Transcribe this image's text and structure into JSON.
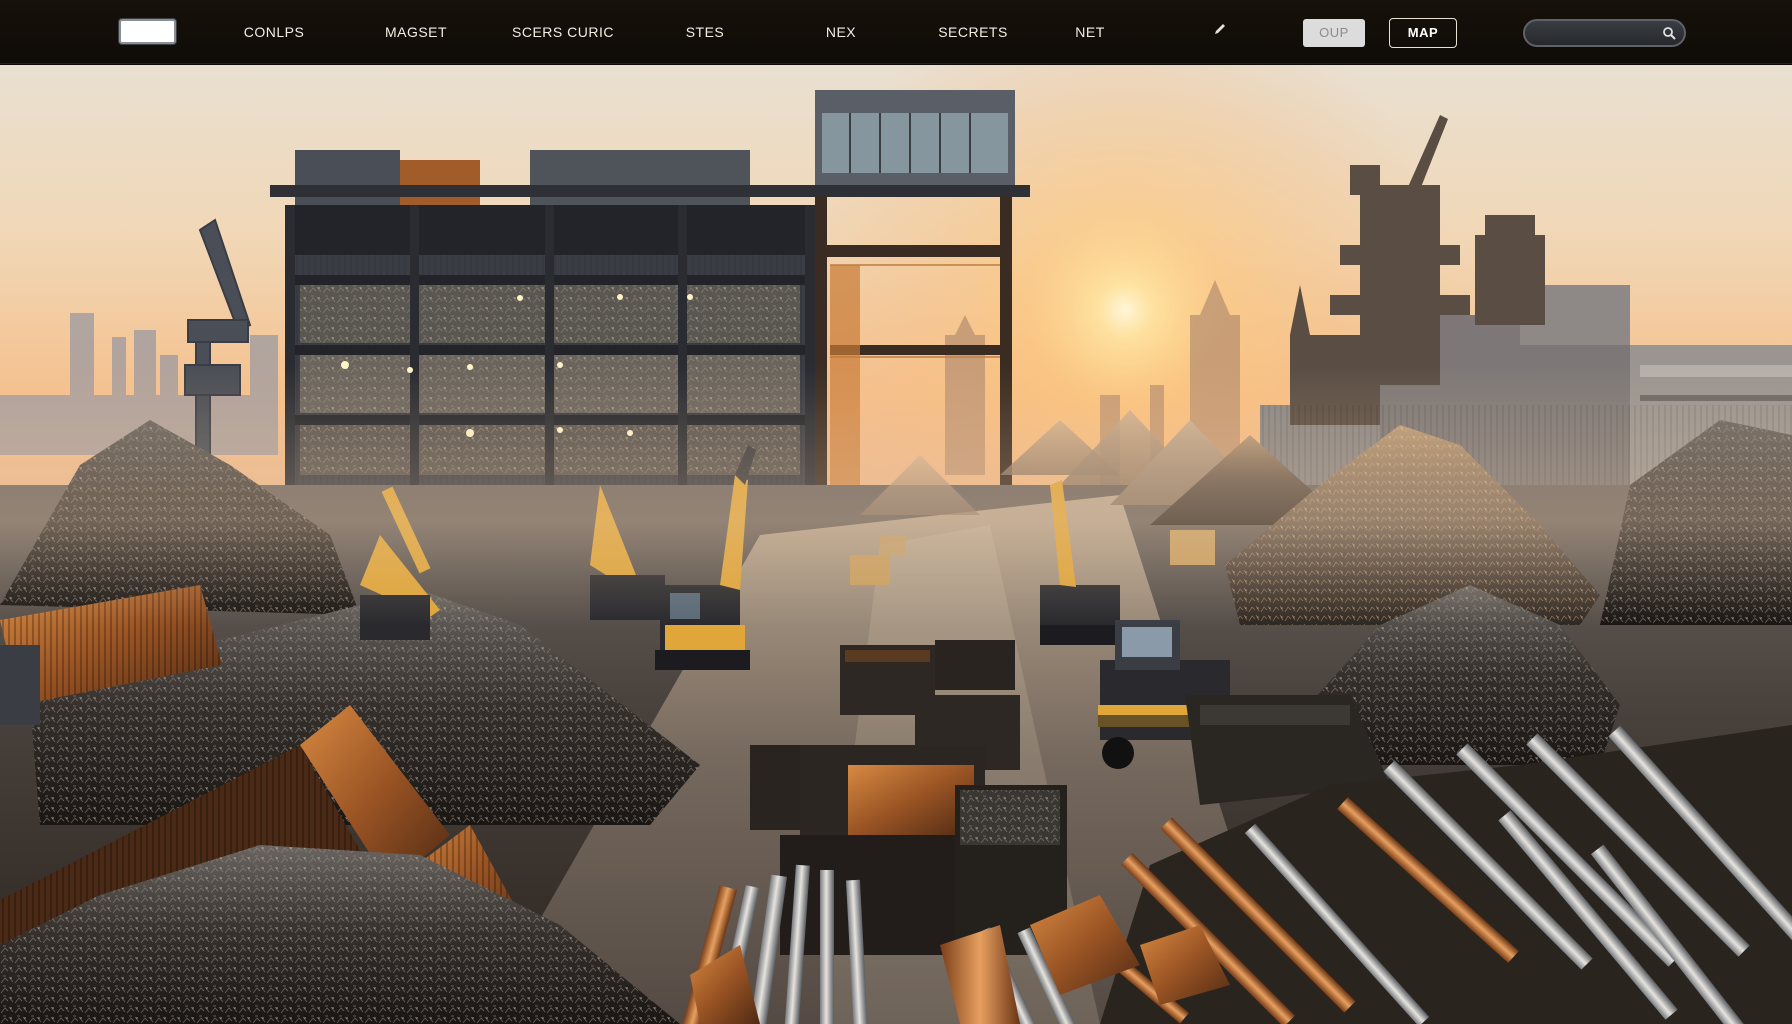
{
  "nav": {
    "logo": "",
    "links": [
      "CONLPS",
      "MAGSET",
      "SCERS CURIC",
      "STES",
      "NEX",
      "SECRETS",
      "NET"
    ],
    "edit_icon": "pencil-icon",
    "button_light": "OUP",
    "button_outline": "MAP",
    "search": {
      "value": "",
      "placeholder": "",
      "icon": "search-icon"
    }
  },
  "hero": {
    "alt": "Scrap metal recycling yard at sunset with sorting plant, excavators, loaders, containers and piles of scrap"
  },
  "colors": {
    "nav_bg": "#110c08",
    "nav_text": "#f2eee6",
    "sky_top": "#f2e2c8",
    "sun": "#ffd98a",
    "rust": "#b5652a",
    "machine_yellow": "#e0a63a"
  }
}
